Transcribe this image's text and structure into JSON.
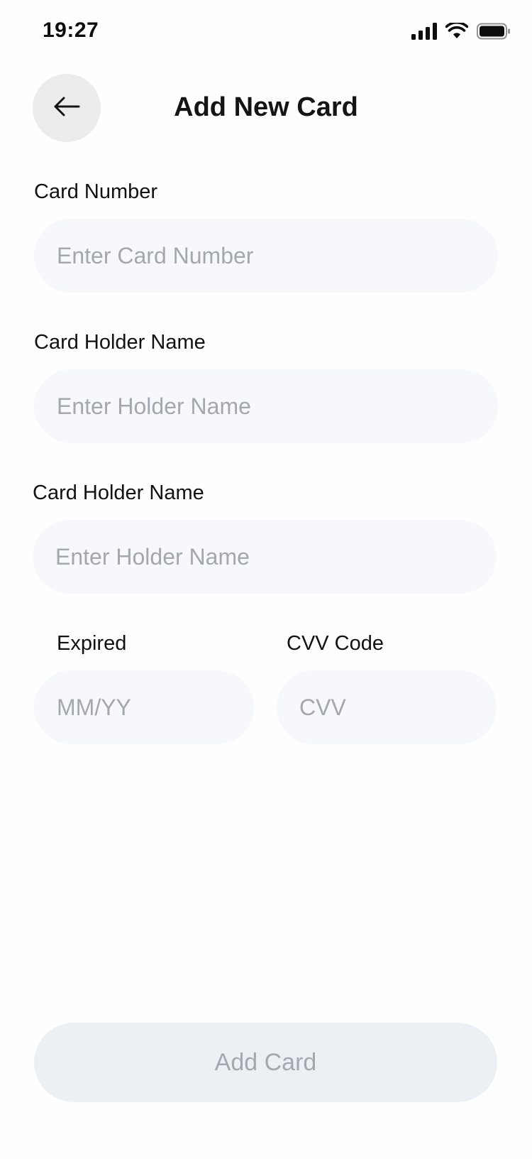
{
  "status_bar": {
    "time": "19:27",
    "icons": [
      "cellular-signal-icon",
      "wifi-icon",
      "battery-icon"
    ]
  },
  "header": {
    "back_icon": "arrow-left-icon",
    "title": "Add New Card"
  },
  "form": {
    "card_number": {
      "label": "Card Number",
      "value": "",
      "placeholder": "Enter Card Number"
    },
    "holder_name": {
      "label": "Card Holder Name",
      "value": "",
      "placeholder": "Enter Holder Name"
    },
    "holder_name_2": {
      "label": "Card Holder Name",
      "value": "",
      "placeholder": "Enter Holder Name"
    },
    "expiry": {
      "label": "Expired",
      "value": "",
      "placeholder": "MM/YY"
    },
    "cvv": {
      "label": "CVV Code",
      "value": "",
      "placeholder": "CVV"
    }
  },
  "actions": {
    "add_card_label": "Add Card"
  },
  "colors": {
    "field_background": "#f7f8fc",
    "placeholder_text": "#a3a8af",
    "button_disabled_background": "#ecf0f5",
    "back_button_background": "#ececec"
  }
}
